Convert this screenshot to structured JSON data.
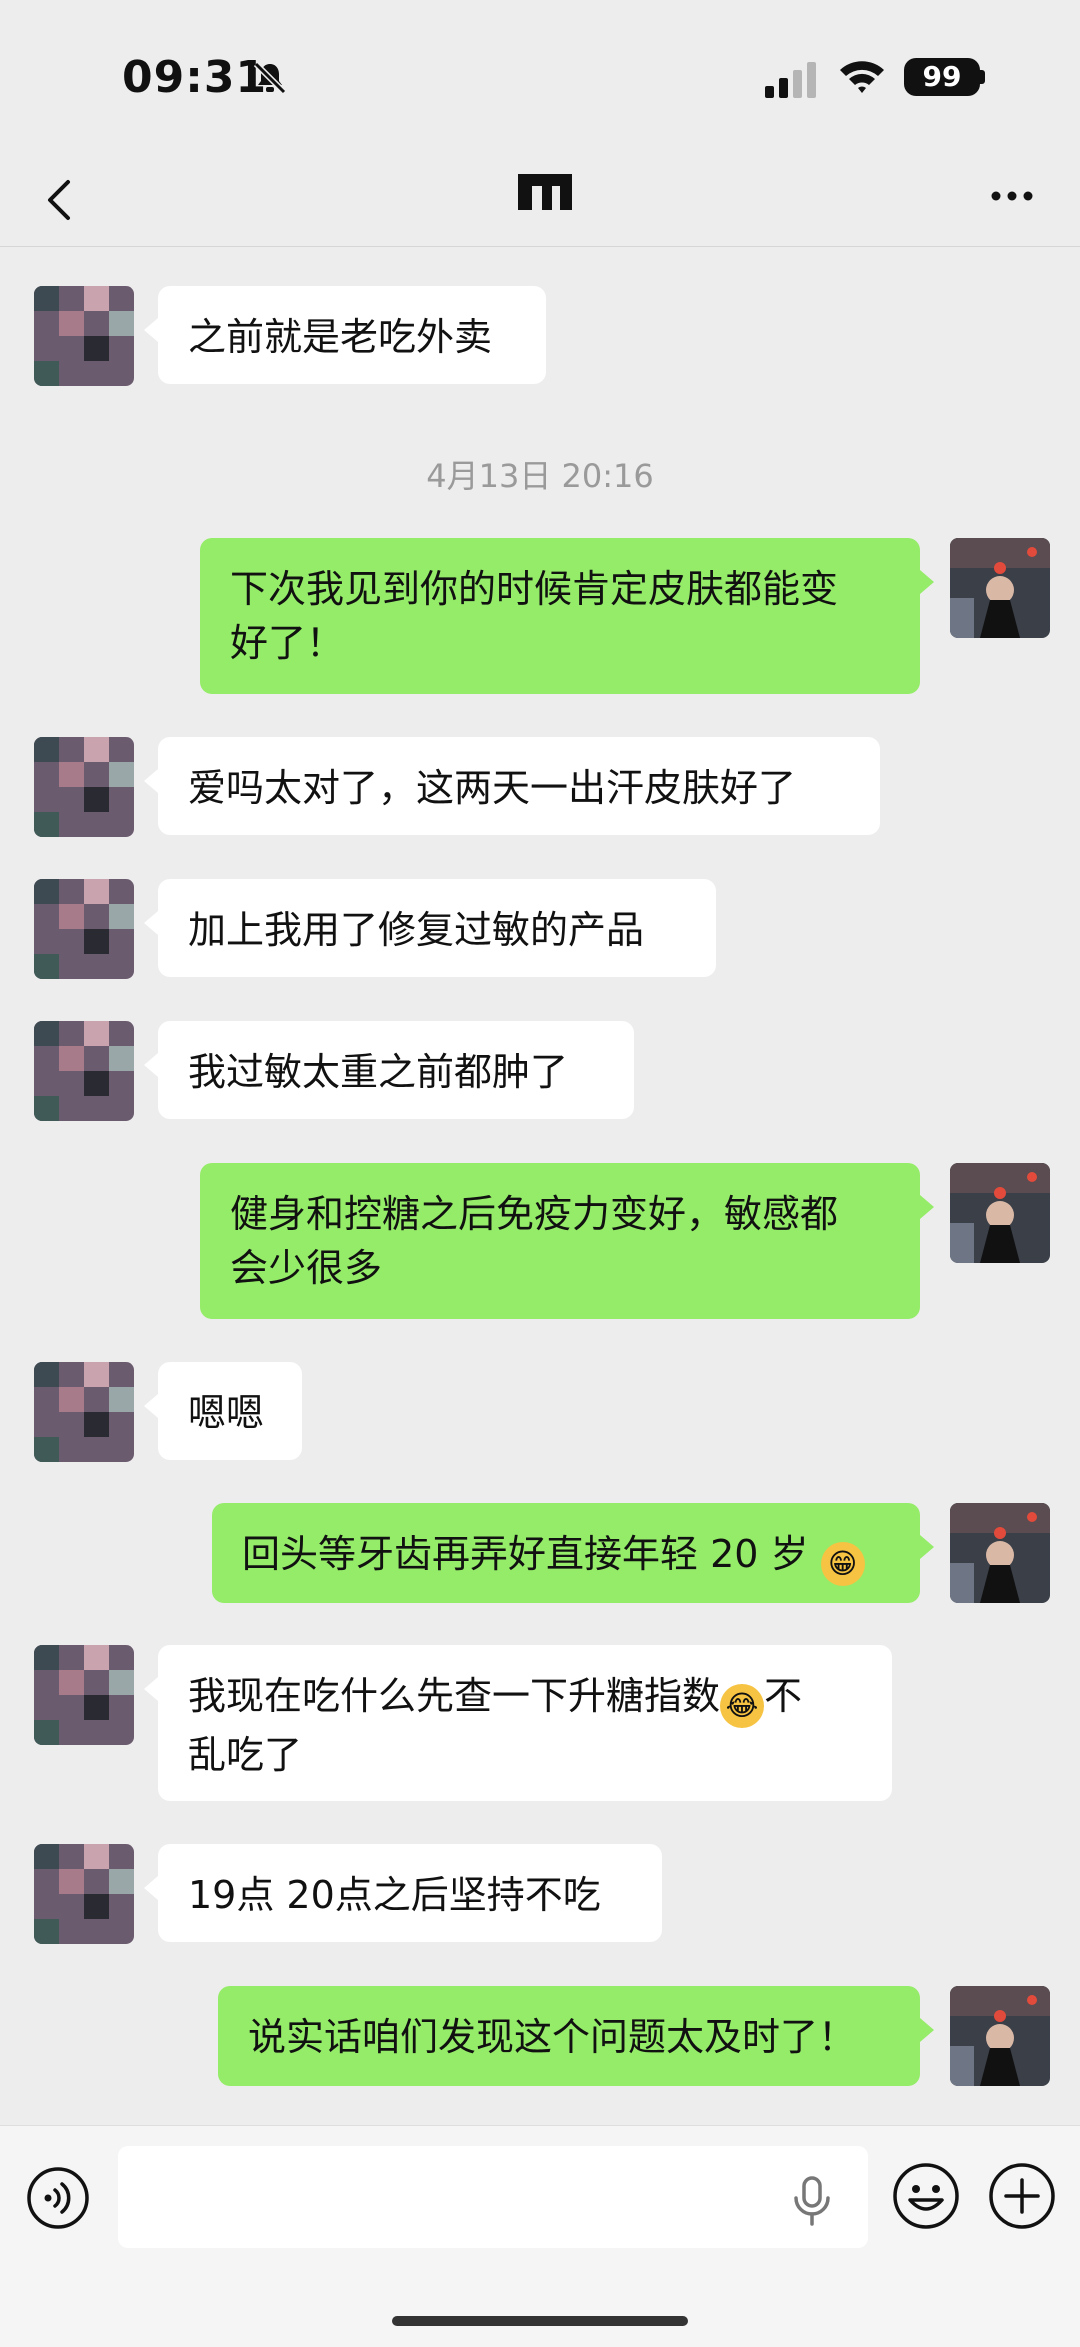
{
  "status_bar": {
    "time": "09:31",
    "battery": "99"
  },
  "nav": {
    "contact_name": ""
  },
  "messages": [
    {
      "text": "之前就是老吃外卖"
    },
    {
      "timestamp": "4月13日 20:16"
    },
    {
      "text1": "下次我见到你的时候肯定皮肤都能变",
      "text2": "好了！"
    },
    {
      "text": "爱吗太对了，这两天一出汗皮肤好了"
    },
    {
      "text": "加上我用了修复过敏的产品"
    },
    {
      "text": "我过敏太重之前都肿了"
    },
    {
      "text1": "健身和控糖之后免疫力变好，敏感都",
      "text2": "会少很多"
    },
    {
      "text": "嗯嗯"
    },
    {
      "text": "回头等牙齿再弄好直接年轻 20 岁",
      "emoji": "grinning-sweat"
    },
    {
      "text_before": "我现在吃什么先查一下升糖指数",
      "text_after": "不",
      "text2": "乱吃了",
      "emoji": "tears-of-joy"
    },
    {
      "text": "19点 20点之后坚持不吃"
    },
    {
      "text": "说实话咱们发现这个问题太及时了！"
    }
  ],
  "input": {
    "placeholder": ""
  },
  "colors": {
    "background": "#ededed",
    "outgoing_bubble": "#95ec69",
    "incoming_bubble": "#ffffff"
  },
  "icons": [
    "back-icon",
    "more-icon",
    "voice-icon",
    "mic-icon",
    "emoji-icon",
    "plus-icon",
    "mute-bell-icon",
    "signal-icon",
    "wifi-icon"
  ]
}
